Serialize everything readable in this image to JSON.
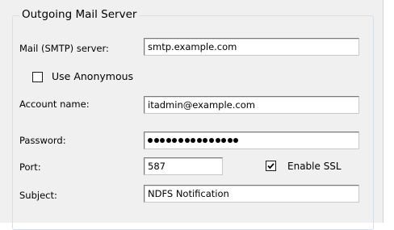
{
  "group": {
    "title": "Outgoing Mail Server"
  },
  "smtp": {
    "label": "Mail (SMTP) server:",
    "value": "smtp.example.com"
  },
  "anonymous": {
    "label": "Use Anonymous",
    "checked": false
  },
  "account": {
    "label": "Account name:",
    "value": "itadmin@example.com"
  },
  "password": {
    "label": "Password:",
    "masked_length": 15
  },
  "port": {
    "label": "Port:",
    "value": "587"
  },
  "ssl": {
    "label": "Enable SSL",
    "checked": true
  },
  "subject": {
    "label": "Subject:",
    "value": "NDFS Notification"
  }
}
